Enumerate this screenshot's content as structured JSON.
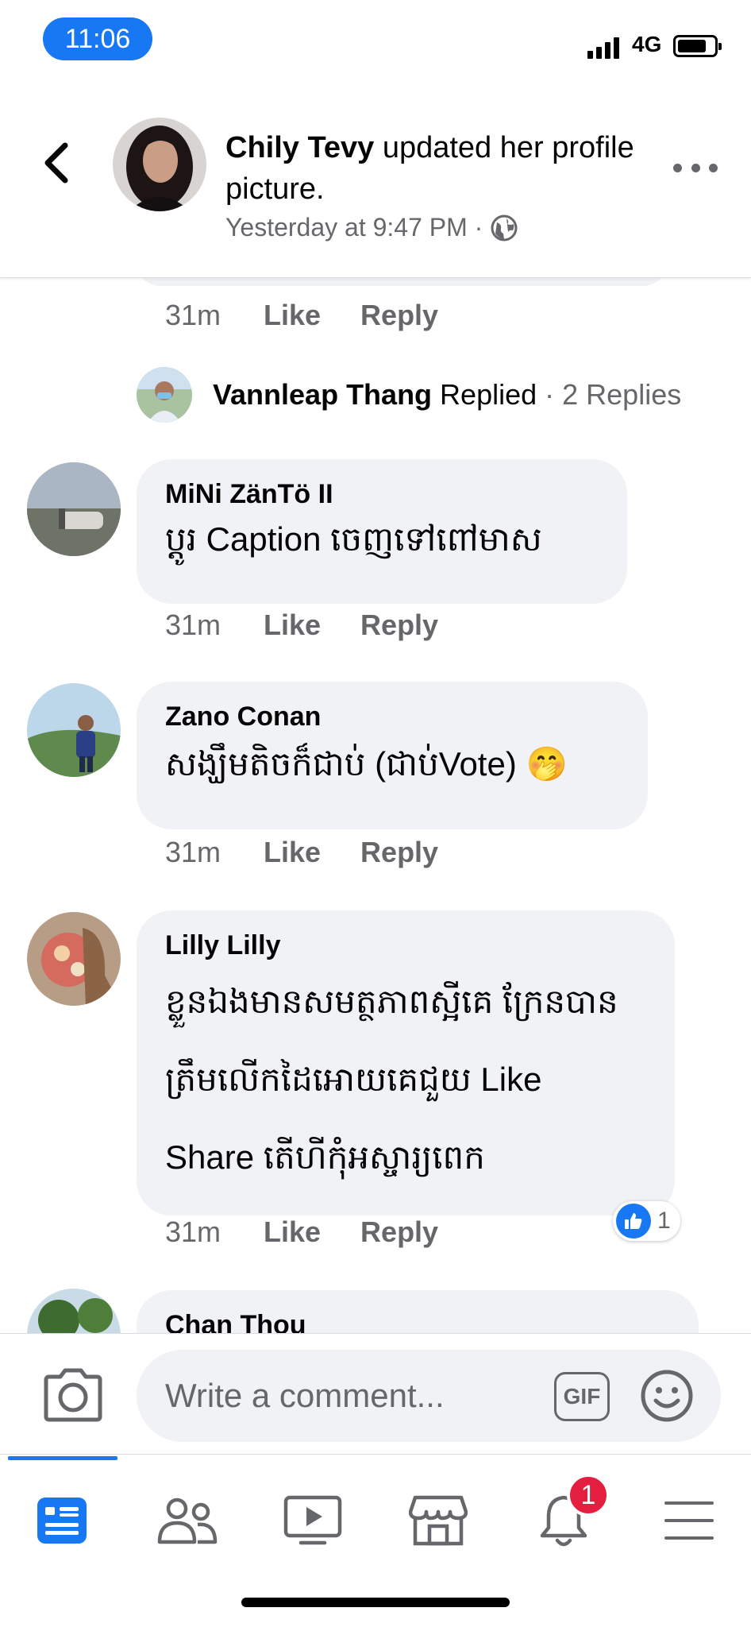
{
  "status_bar": {
    "time": "11:06",
    "network": "4G"
  },
  "header": {
    "author": "Chily Tevy",
    "action": " updated her profile picture.",
    "meta": "Yesterday at 9:47 PM ·",
    "icons": {
      "back": "chevron-left-icon",
      "more": "more-icon",
      "audience": "globe-icon"
    }
  },
  "comments": {
    "first_thread": {
      "time": "31m",
      "like": "Like",
      "reply": "Reply",
      "replied_by": "Vannleap Thang",
      "replied_verb": "Replied",
      "replied_count": "· 2 Replies"
    },
    "items": [
      {
        "author": "MiNi ZänTö II",
        "text": "ប្តូរ Caption ចេញទៅពៅមាស",
        "time": "31m",
        "like": "Like",
        "reply": "Reply"
      },
      {
        "author": "Zano Conan",
        "text": "សង្ឃឹមតិចក៏ជាប់ (ជាប់Vote) 🤭",
        "time": "31m",
        "like": "Like",
        "reply": "Reply"
      },
      {
        "author": "Lilly Lilly",
        "text": [
          "ខ្លួនឯងមានសមត្ថភាពស្អីគេ ក្រែនបាន",
          "ត្រឹមលើកដៃអោយគេជួយ Like",
          "Share តើហីកុំអស្ចារ្យពេក"
        ],
        "time": "31m",
        "like": "Like",
        "reply": "Reply",
        "reaction_count": "1"
      },
      {
        "author": "Chan Thou"
      }
    ]
  },
  "composer": {
    "placeholder": "Write a comment...",
    "gif_label": "GIF",
    "icons": {
      "camera": "camera-icon",
      "emoji": "emoji-icon"
    }
  },
  "bottom_nav": {
    "items": [
      "news-feed-icon",
      "friends-icon",
      "watch-icon",
      "marketplace-icon",
      "notifications-icon",
      "menu-icon"
    ],
    "active": "news-feed-icon",
    "notification_badge": "1"
  },
  "colors": {
    "accent": "#1877f2",
    "bubble": "#f0f2f5",
    "secondary_text": "#65676b",
    "badge": "#e41e3f"
  }
}
